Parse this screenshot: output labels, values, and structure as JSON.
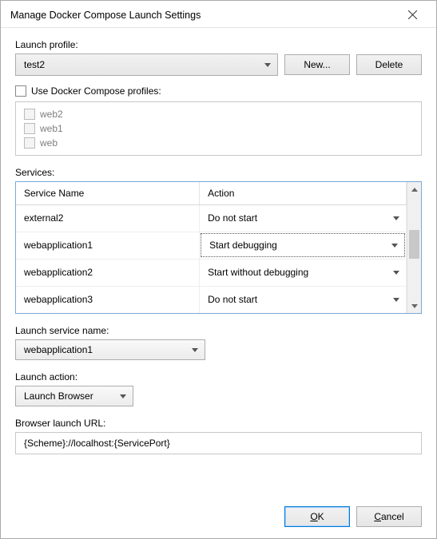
{
  "window": {
    "title": "Manage Docker Compose Launch Settings"
  },
  "labels": {
    "launch_profile": "Launch profile:",
    "use_profiles": "Use Docker Compose profiles:",
    "services": "Services:",
    "service_name_col": "Service Name",
    "action_col": "Action",
    "launch_service_name": "Launch service name:",
    "launch_action": "Launch action:",
    "browser_launch_url": "Browser launch URL:"
  },
  "buttons": {
    "new": "New...",
    "delete": "Delete",
    "ok": "OK",
    "cancel": "Cancel"
  },
  "profile_dropdown": {
    "value": "test2"
  },
  "use_profiles_checked": false,
  "compose_profiles": [
    {
      "name": "web2",
      "checked": false
    },
    {
      "name": "web1",
      "checked": false
    },
    {
      "name": "web",
      "checked": false
    }
  ],
  "services_rows": [
    {
      "name": "external2",
      "action": "Do not start",
      "focused": false
    },
    {
      "name": "webapplication1",
      "action": "Start debugging",
      "focused": true
    },
    {
      "name": "webapplication2",
      "action": "Start without debugging",
      "focused": false
    },
    {
      "name": "webapplication3",
      "action": "Do not start",
      "focused": false
    }
  ],
  "launch_service_name": {
    "value": "webapplication1"
  },
  "launch_action": {
    "value": "Launch Browser"
  },
  "browser_launch_url": {
    "value": "{Scheme}://localhost:{ServicePort}"
  }
}
